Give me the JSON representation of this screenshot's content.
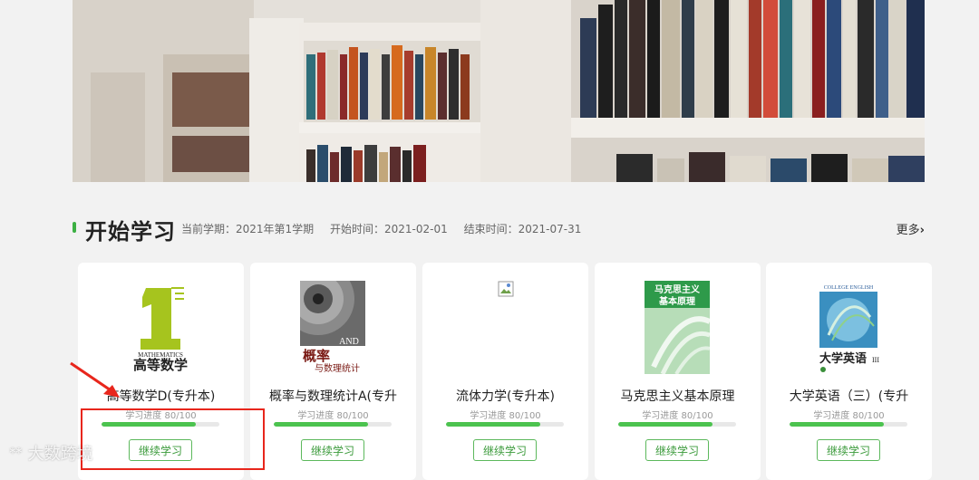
{
  "section": {
    "title": "开始学习",
    "semester": "当前学期：2021年第1学期",
    "start": "开始时间：2021-02-01",
    "end": "结束时间：2021-07-31",
    "more": "更多"
  },
  "courses": [
    {
      "name": "高等数学D(专升本)",
      "progress_label": "学习进度 80/100",
      "progress": 0.8,
      "button": "继续学习",
      "cover_text": "高等数学",
      "cover_sub": "MATHEMATICS"
    },
    {
      "name": "概率与数理统计A(专升",
      "progress_label": "学习进度 80/100",
      "progress": 0.8,
      "button": "继续学习",
      "cover_text": "概率",
      "cover_sub": "与数理统计",
      "cover_en": "AND"
    },
    {
      "name": "流体力学(专升本)",
      "progress_label": "学习进度 80/100",
      "progress": 0.8,
      "button": "继续学习"
    },
    {
      "name": "马克思主义基本原理",
      "progress_label": "学习进度 80/100",
      "progress": 0.8,
      "button": "继续学习",
      "cover_text": "马克思主义",
      "cover_sub": "基本原理"
    },
    {
      "name": "大学英语（三）(专升",
      "progress_label": "学习进度 80/100",
      "progress": 0.8,
      "button": "继续学习",
      "cover_text": "大学英语",
      "cover_en": "COLLEGE ENGLISH"
    }
  ],
  "watermark": "大数跨境",
  "colors": {
    "accent": "#3cb043",
    "annotation": "#e8261c"
  }
}
